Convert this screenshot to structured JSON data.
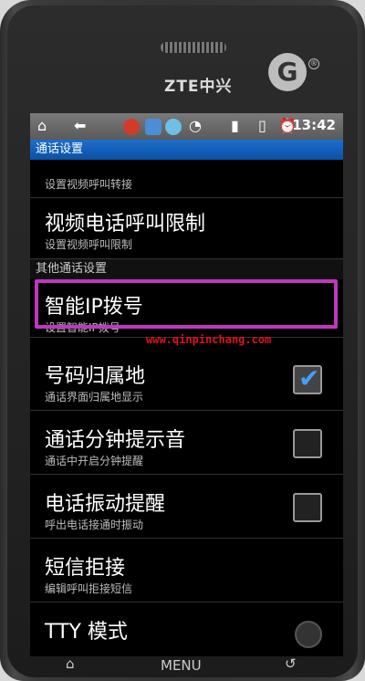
{
  "device": {
    "brand": "ZTE中兴",
    "logo_glyph": "G",
    "logo_reg": "®"
  },
  "statusbar": {
    "icons": [
      "home-icon",
      "back-icon",
      "app-notify-icon",
      "map-icon",
      "chat-icon",
      "wifi-icon",
      "signal-icon",
      "battery-icon",
      "alarm-icon"
    ],
    "time": "13:42"
  },
  "sections": {
    "call_settings": "通话设置",
    "other_settings": "其他通话设置"
  },
  "items": [
    {
      "title": "",
      "subtitle": "设置视频呼叫转接"
    },
    {
      "title": "视频电话呼叫限制",
      "subtitle": "设置视频呼叫限制"
    },
    {
      "title": "智能IP拨号",
      "subtitle": "设置智能IP拨号"
    },
    {
      "title": "号码归属地",
      "subtitle": "通话界面归属地显示",
      "checked": true
    },
    {
      "title": "通话分钟提示音",
      "subtitle": "通话中开启分钟提醒",
      "checked": false
    },
    {
      "title": "电话振动提醒",
      "subtitle": "呼出电话接通时振动",
      "checked": false
    },
    {
      "title": "短信拒接",
      "subtitle": "编辑呼叫拒接短信"
    },
    {
      "title": "TTY 模式",
      "subtitle": ""
    }
  ],
  "watermark": "www.qinpinchang.com",
  "keys": {
    "menu": "MENU"
  },
  "colors": {
    "header_blue": "#0b50a6",
    "highlight": "#c036c0",
    "check_blue": "#3fa0ff"
  }
}
